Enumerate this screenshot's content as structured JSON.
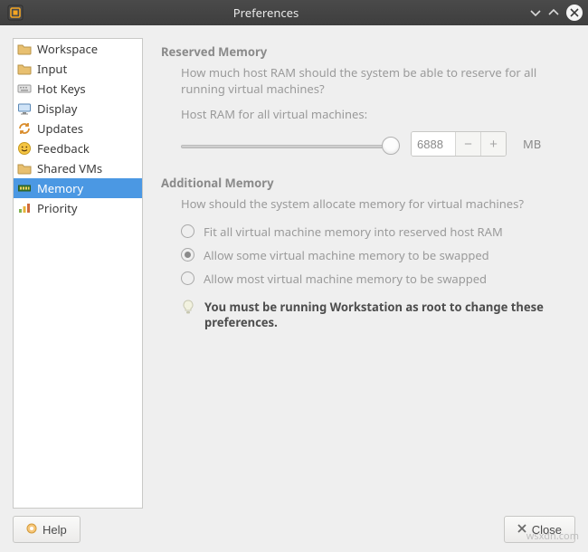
{
  "titlebar": {
    "title": "Preferences"
  },
  "sidebar": {
    "items": [
      {
        "label": "Workspace",
        "icon": "folder-icon",
        "selected": false
      },
      {
        "label": "Input",
        "icon": "folder-icon",
        "selected": false
      },
      {
        "label": "Hot Keys",
        "icon": "keyboard-icon",
        "selected": false
      },
      {
        "label": "Display",
        "icon": "display-icon",
        "selected": false
      },
      {
        "label": "Updates",
        "icon": "updates-icon",
        "selected": false
      },
      {
        "label": "Feedback",
        "icon": "smiley-icon",
        "selected": false
      },
      {
        "label": "Shared VMs",
        "icon": "folder-icon",
        "selected": false
      },
      {
        "label": "Memory",
        "icon": "memory-icon",
        "selected": true
      },
      {
        "label": "Priority",
        "icon": "priority-icon",
        "selected": false
      }
    ]
  },
  "content": {
    "reserved": {
      "title": "Reserved Memory",
      "desc": "How much host RAM should the system be able to reserve for all running virtual machines?",
      "slider_label": "Host RAM for all virtual machines:",
      "value": "6888",
      "unit": "MB"
    },
    "additional": {
      "title": "Additional Memory",
      "desc": "How should the system allocate memory for virtual machines?",
      "options": [
        {
          "label": "Fit all virtual machine memory into reserved host RAM",
          "checked": false
        },
        {
          "label": "Allow some virtual machine memory to be swapped",
          "checked": true
        },
        {
          "label": "Allow most virtual machine memory to be swapped",
          "checked": false
        }
      ]
    },
    "warning": "You must be running Workstation as root to change these preferences."
  },
  "footer": {
    "help_label": "Help",
    "close_label": "Close"
  },
  "watermark": "wsxdn.com"
}
